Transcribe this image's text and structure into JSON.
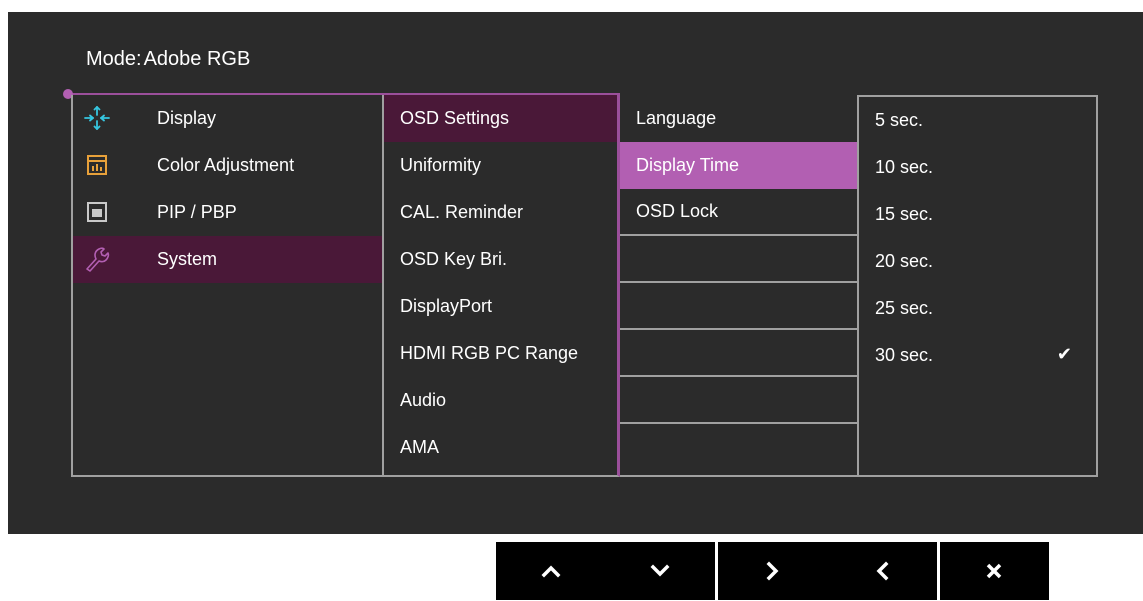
{
  "mode": {
    "label": "Mode:",
    "value": "Adobe RGB"
  },
  "main_menu": [
    {
      "label": "Display",
      "icon": "display-icon"
    },
    {
      "label": "Color Adjustment",
      "icon": "color-adjustment-icon"
    },
    {
      "label": "PIP / PBP",
      "icon": "pip-pbp-icon"
    },
    {
      "label": "System",
      "icon": "wrench-icon",
      "selected": true
    }
  ],
  "system_menu": [
    {
      "label": "OSD Settings",
      "selected": true
    },
    {
      "label": "Uniformity"
    },
    {
      "label": "CAL. Reminder"
    },
    {
      "label": "OSD Key Bri."
    },
    {
      "label": "DisplayPort"
    },
    {
      "label": "HDMI RGB PC Range"
    },
    {
      "label": "Audio"
    },
    {
      "label": "AMA"
    }
  ],
  "osd_menu": [
    {
      "label": "Language"
    },
    {
      "label": "Display Time",
      "selected": true
    },
    {
      "label": "OSD Lock"
    }
  ],
  "display_time_options": [
    {
      "label": "5 sec."
    },
    {
      "label": "10 sec."
    },
    {
      "label": "15 sec."
    },
    {
      "label": "20 sec."
    },
    {
      "label": "25 sec."
    },
    {
      "label": "30 sec.",
      "checked": true
    }
  ],
  "check_mark": "✔",
  "buttons": {
    "up": "⌃",
    "down": "⌄",
    "right": ">",
    "left": "<",
    "close": "✕"
  },
  "colors": {
    "panel_bg": "#2b2b2b",
    "accent": "#b25fb2",
    "selected_dark": "#4a1838",
    "icon_cyan": "#36c6e0",
    "icon_orange": "#e8a13a",
    "icon_gray": "#c9c9c9",
    "icon_purple": "#b25fb2"
  }
}
